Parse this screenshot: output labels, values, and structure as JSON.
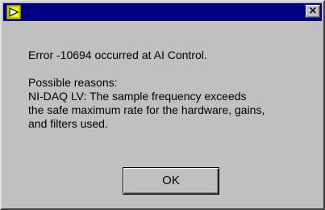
{
  "window": {
    "title": "",
    "close_symbol": "×"
  },
  "icons": {
    "app": "labview-run-arrow-icon",
    "close": "close-icon"
  },
  "colors": {
    "titlebar": "#000080",
    "face": "#c0c0c0",
    "icon_yellow": "#ffff00"
  },
  "message": {
    "error_line": "Error -10694 occurred at AI Control.",
    "reasons_heading": "Possible reasons:",
    "reason_lines": [
      "NI-DAQ LV:  The sample frequency exceeds",
      "the safe maximum rate for the hardware, gains,",
      "and filters used."
    ]
  },
  "buttons": {
    "ok_label": "OK"
  }
}
